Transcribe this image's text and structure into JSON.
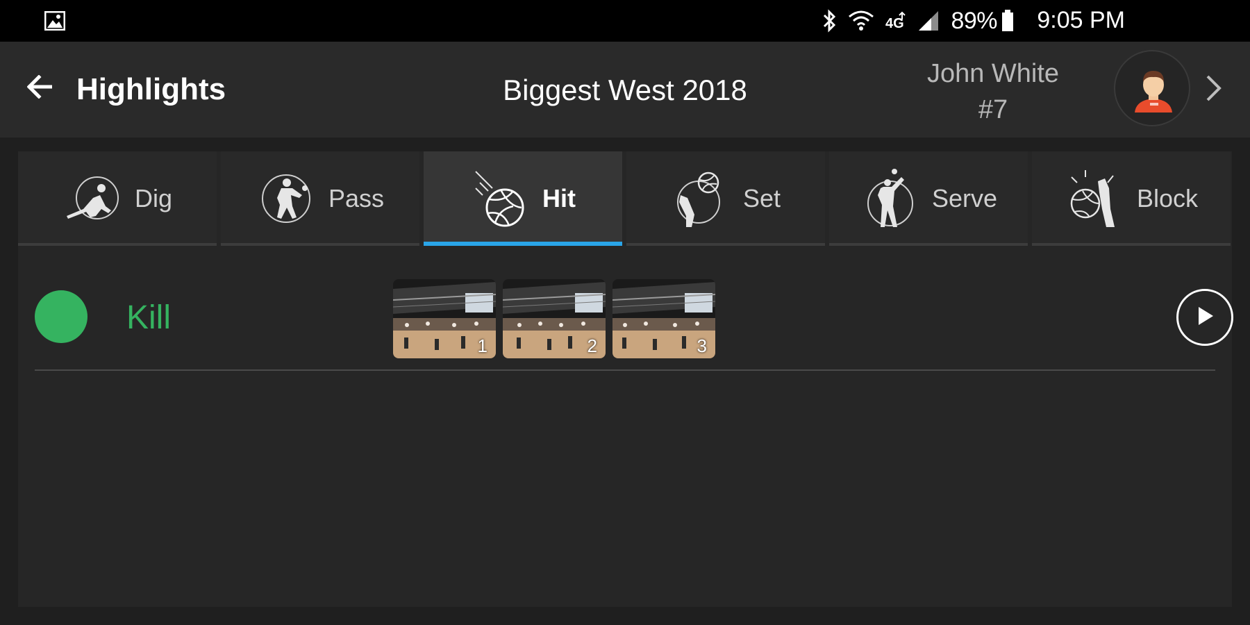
{
  "status_bar": {
    "battery": "89%",
    "time": "9:05 PM",
    "icons": [
      "image-icon",
      "bluetooth-icon",
      "wifi-icon",
      "lte-icon",
      "signal-icon",
      "battery-icon"
    ]
  },
  "app_bar": {
    "title": "Highlights",
    "event": "Biggest West 2018",
    "player_name": "John White",
    "player_number": "#7"
  },
  "tabs": [
    {
      "label": "Dig",
      "icon": "dig-icon",
      "active": false
    },
    {
      "label": "Pass",
      "icon": "pass-icon",
      "active": false
    },
    {
      "label": "Hit",
      "icon": "hit-icon",
      "active": true
    },
    {
      "label": "Set",
      "icon": "set-icon",
      "active": false
    },
    {
      "label": "Serve",
      "icon": "serve-icon",
      "active": false
    },
    {
      "label": "Block",
      "icon": "block-icon",
      "active": false
    }
  ],
  "results": [
    {
      "label": "Kill",
      "color": "#35b360",
      "clips": [
        "1",
        "2",
        "3"
      ]
    }
  ],
  "colors": {
    "accent": "#2aa5e8",
    "kill": "#35b360",
    "background": "#1f1f1f"
  }
}
